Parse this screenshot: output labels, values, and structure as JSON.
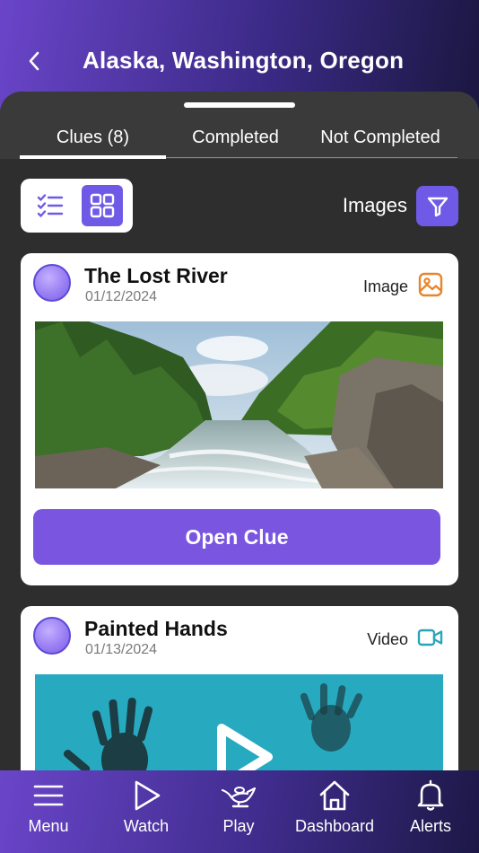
{
  "header": {
    "title": "Alaska, Washington, Oregon"
  },
  "tabs": [
    {
      "label": "Clues (8)",
      "active": true
    },
    {
      "label": "Completed",
      "active": false
    },
    {
      "label": "Not Completed",
      "active": false
    }
  ],
  "toolbar": {
    "filter_label": "Images",
    "view_mode": "grid"
  },
  "clues": [
    {
      "title": "The Lost River",
      "date": "01/12/2024",
      "type": "Image",
      "type_icon": "image-icon",
      "type_color": "#e8852a",
      "button_label": "Open Clue"
    },
    {
      "title": "Painted Hands",
      "date": "01/13/2024",
      "type": "Video",
      "type_icon": "video-icon",
      "type_color": "#2aa5b8"
    }
  ],
  "bottom_nav": [
    {
      "label": "Menu",
      "icon": "menu-icon"
    },
    {
      "label": "Watch",
      "icon": "play-icon"
    },
    {
      "label": "Play",
      "icon": "genie-lamp-icon"
    },
    {
      "label": "Dashboard",
      "icon": "home-icon"
    },
    {
      "label": "Alerts",
      "icon": "bell-icon"
    }
  ],
  "colors": {
    "accent": "#6f5ae8",
    "button": "#7a55e0",
    "header_start": "#6a45c9",
    "header_end": "#1a1740"
  }
}
